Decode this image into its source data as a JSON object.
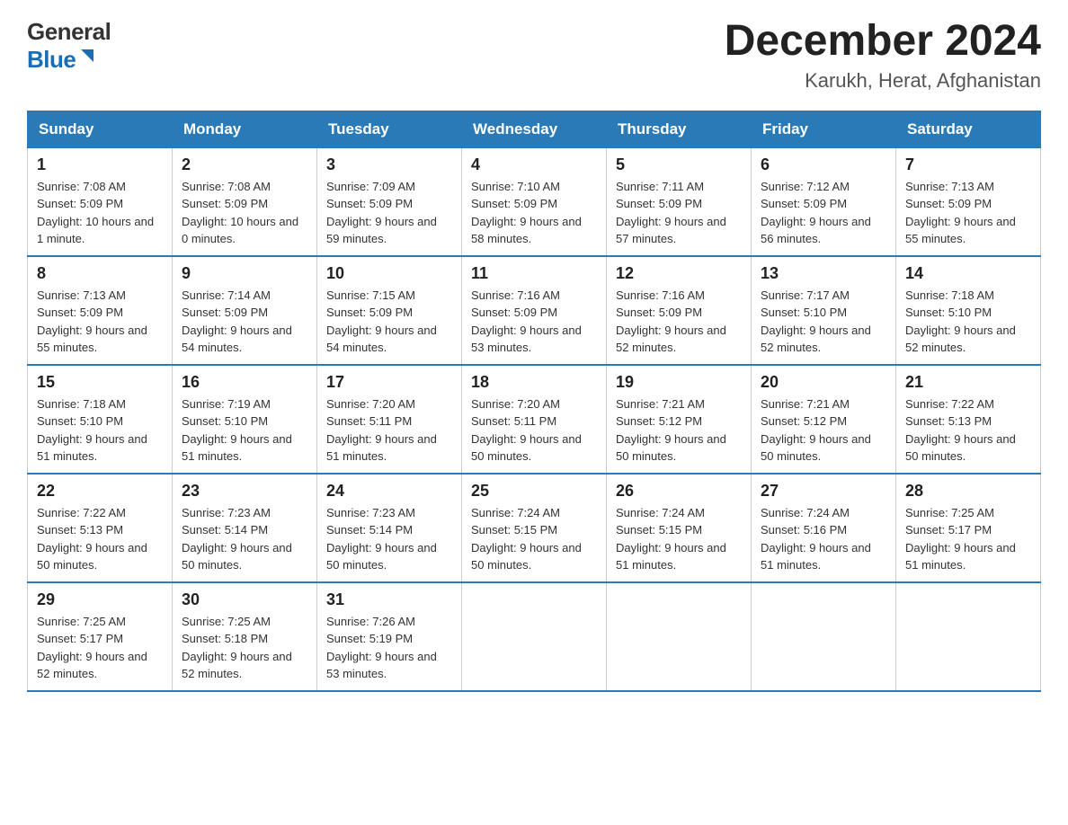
{
  "logo": {
    "line1": "General",
    "line2": "Blue"
  },
  "header": {
    "month": "December 2024",
    "location": "Karukh, Herat, Afghanistan"
  },
  "weekdays": [
    "Sunday",
    "Monday",
    "Tuesday",
    "Wednesday",
    "Thursday",
    "Friday",
    "Saturday"
  ],
  "weeks": [
    [
      {
        "day": "1",
        "sunrise": "7:08 AM",
        "sunset": "5:09 PM",
        "daylight": "10 hours and 1 minute."
      },
      {
        "day": "2",
        "sunrise": "7:08 AM",
        "sunset": "5:09 PM",
        "daylight": "10 hours and 0 minutes."
      },
      {
        "day": "3",
        "sunrise": "7:09 AM",
        "sunset": "5:09 PM",
        "daylight": "9 hours and 59 minutes."
      },
      {
        "day": "4",
        "sunrise": "7:10 AM",
        "sunset": "5:09 PM",
        "daylight": "9 hours and 58 minutes."
      },
      {
        "day": "5",
        "sunrise": "7:11 AM",
        "sunset": "5:09 PM",
        "daylight": "9 hours and 57 minutes."
      },
      {
        "day": "6",
        "sunrise": "7:12 AM",
        "sunset": "5:09 PM",
        "daylight": "9 hours and 56 minutes."
      },
      {
        "day": "7",
        "sunrise": "7:13 AM",
        "sunset": "5:09 PM",
        "daylight": "9 hours and 55 minutes."
      }
    ],
    [
      {
        "day": "8",
        "sunrise": "7:13 AM",
        "sunset": "5:09 PM",
        "daylight": "9 hours and 55 minutes."
      },
      {
        "day": "9",
        "sunrise": "7:14 AM",
        "sunset": "5:09 PM",
        "daylight": "9 hours and 54 minutes."
      },
      {
        "day": "10",
        "sunrise": "7:15 AM",
        "sunset": "5:09 PM",
        "daylight": "9 hours and 54 minutes."
      },
      {
        "day": "11",
        "sunrise": "7:16 AM",
        "sunset": "5:09 PM",
        "daylight": "9 hours and 53 minutes."
      },
      {
        "day": "12",
        "sunrise": "7:16 AM",
        "sunset": "5:09 PM",
        "daylight": "9 hours and 52 minutes."
      },
      {
        "day": "13",
        "sunrise": "7:17 AM",
        "sunset": "5:10 PM",
        "daylight": "9 hours and 52 minutes."
      },
      {
        "day": "14",
        "sunrise": "7:18 AM",
        "sunset": "5:10 PM",
        "daylight": "9 hours and 52 minutes."
      }
    ],
    [
      {
        "day": "15",
        "sunrise": "7:18 AM",
        "sunset": "5:10 PM",
        "daylight": "9 hours and 51 minutes."
      },
      {
        "day": "16",
        "sunrise": "7:19 AM",
        "sunset": "5:10 PM",
        "daylight": "9 hours and 51 minutes."
      },
      {
        "day": "17",
        "sunrise": "7:20 AM",
        "sunset": "5:11 PM",
        "daylight": "9 hours and 51 minutes."
      },
      {
        "day": "18",
        "sunrise": "7:20 AM",
        "sunset": "5:11 PM",
        "daylight": "9 hours and 50 minutes."
      },
      {
        "day": "19",
        "sunrise": "7:21 AM",
        "sunset": "5:12 PM",
        "daylight": "9 hours and 50 minutes."
      },
      {
        "day": "20",
        "sunrise": "7:21 AM",
        "sunset": "5:12 PM",
        "daylight": "9 hours and 50 minutes."
      },
      {
        "day": "21",
        "sunrise": "7:22 AM",
        "sunset": "5:13 PM",
        "daylight": "9 hours and 50 minutes."
      }
    ],
    [
      {
        "day": "22",
        "sunrise": "7:22 AM",
        "sunset": "5:13 PM",
        "daylight": "9 hours and 50 minutes."
      },
      {
        "day": "23",
        "sunrise": "7:23 AM",
        "sunset": "5:14 PM",
        "daylight": "9 hours and 50 minutes."
      },
      {
        "day": "24",
        "sunrise": "7:23 AM",
        "sunset": "5:14 PM",
        "daylight": "9 hours and 50 minutes."
      },
      {
        "day": "25",
        "sunrise": "7:24 AM",
        "sunset": "5:15 PM",
        "daylight": "9 hours and 50 minutes."
      },
      {
        "day": "26",
        "sunrise": "7:24 AM",
        "sunset": "5:15 PM",
        "daylight": "9 hours and 51 minutes."
      },
      {
        "day": "27",
        "sunrise": "7:24 AM",
        "sunset": "5:16 PM",
        "daylight": "9 hours and 51 minutes."
      },
      {
        "day": "28",
        "sunrise": "7:25 AM",
        "sunset": "5:17 PM",
        "daylight": "9 hours and 51 minutes."
      }
    ],
    [
      {
        "day": "29",
        "sunrise": "7:25 AM",
        "sunset": "5:17 PM",
        "daylight": "9 hours and 52 minutes."
      },
      {
        "day": "30",
        "sunrise": "7:25 AM",
        "sunset": "5:18 PM",
        "daylight": "9 hours and 52 minutes."
      },
      {
        "day": "31",
        "sunrise": "7:26 AM",
        "sunset": "5:19 PM",
        "daylight": "9 hours and 53 minutes."
      },
      null,
      null,
      null,
      null
    ]
  ],
  "labels": {
    "sunrise": "Sunrise:",
    "sunset": "Sunset:",
    "daylight": "Daylight:"
  }
}
